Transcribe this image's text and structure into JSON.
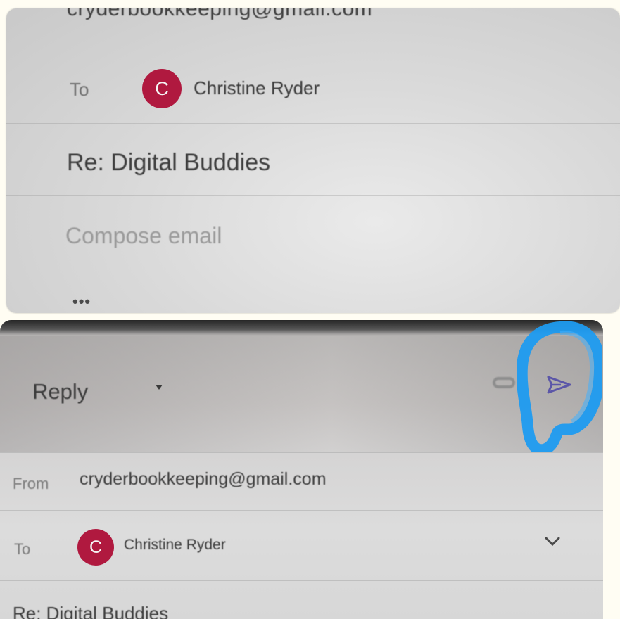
{
  "top_panel": {
    "from_partial": "cryderbookkeeping@gmail.com",
    "to_label": "To",
    "recipient_initial": "C",
    "recipient_name": "Christine Ryder",
    "subject": "Re: Digital Buddies",
    "compose_placeholder": "Compose email",
    "more_label": "•••"
  },
  "bottom_panel": {
    "reply_label": "Reply",
    "from_label": "From",
    "from_value": "cryderbookkeeping@gmail.com",
    "to_label": "To",
    "recipient_initial": "C",
    "recipient_name": "Christine Ryder",
    "subject": "Re: Digital Buddies"
  },
  "icons": {
    "attach": "paperclip-icon",
    "send": "send-icon",
    "reply_dropdown": "caret-down-icon",
    "expand": "chevron-down-icon"
  },
  "colors": {
    "avatar": "#b0193f",
    "send_icon": "#5b56a8",
    "annotation_circle": "#1e9bf0"
  }
}
